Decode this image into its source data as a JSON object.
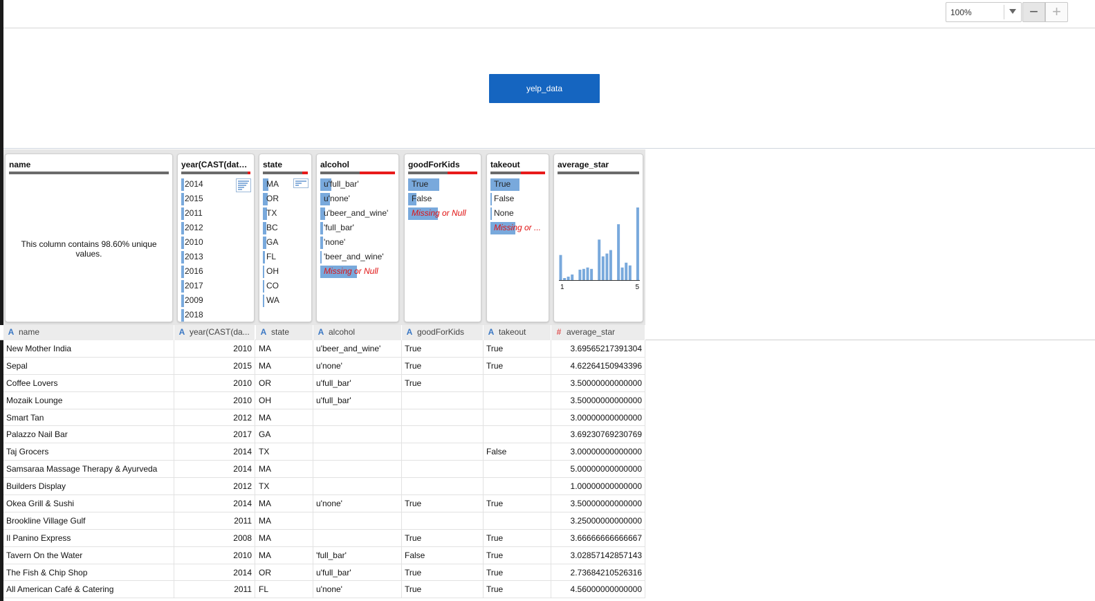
{
  "toolbar": {
    "zoom_value": "100%",
    "zoom_out_symbol": "−",
    "zoom_in_symbol": "+"
  },
  "canvas": {
    "dataset_label": "yelp_data"
  },
  "profile": {
    "name": {
      "title": "name",
      "message": "This column contains 98.60% unique values."
    },
    "year": {
      "title": "year(CAST(date ...",
      "values": [
        {
          "label": "2014",
          "fraction": 0.04
        },
        {
          "label": "2015",
          "fraction": 0.04
        },
        {
          "label": "2011",
          "fraction": 0.04
        },
        {
          "label": "2012",
          "fraction": 0.04
        },
        {
          "label": "2010",
          "fraction": 0.04
        },
        {
          "label": "2013",
          "fraction": 0.04
        },
        {
          "label": "2016",
          "fraction": 0.04
        },
        {
          "label": "2017",
          "fraction": 0.04
        },
        {
          "label": "2009",
          "fraction": 0.04
        },
        {
          "label": "2018",
          "fraction": 0.04
        }
      ],
      "missing_fraction": 0.04
    },
    "state": {
      "title": "state",
      "values": [
        {
          "label": "MA",
          "fraction": 0.12
        },
        {
          "label": "OR",
          "fraction": 0.1
        },
        {
          "label": "TX",
          "fraction": 0.09
        },
        {
          "label": "BC",
          "fraction": 0.08
        },
        {
          "label": "GA",
          "fraction": 0.07
        },
        {
          "label": "FL",
          "fraction": 0.05
        },
        {
          "label": "OH",
          "fraction": 0.03
        },
        {
          "label": "CO",
          "fraction": 0.01
        },
        {
          "label": "WA",
          "fraction": 0.02
        }
      ],
      "missing_fraction": 0.12
    },
    "alcohol": {
      "title": "alcohol",
      "values": [
        {
          "label": "u'full_bar'",
          "fraction": 0.15
        },
        {
          "label": "u'none'",
          "fraction": 0.13
        },
        {
          "label": "u'beer_and_wine'",
          "fraction": 0.06
        },
        {
          "label": "'full_bar'",
          "fraction": 0.04
        },
        {
          "label": "'none'",
          "fraction": 0.04
        },
        {
          "label": "'beer_and_wine'",
          "fraction": 0.02
        },
        {
          "label": "Missing or Null",
          "fraction": 0.49,
          "missing": true
        }
      ],
      "missing_fraction": 0.47
    },
    "goodForKids": {
      "title": "goodForKids",
      "values": [
        {
          "label": "True",
          "fraction": 0.45
        },
        {
          "label": "False",
          "fraction": 0.12
        },
        {
          "label": "Missing or Null",
          "fraction": 0.43,
          "missing": true
        }
      ],
      "missing_fraction": 0.43
    },
    "takeout": {
      "title": "takeout",
      "values": [
        {
          "label": "True",
          "fraction": 0.53
        },
        {
          "label": "False",
          "fraction": 0.03
        },
        {
          "label": "None",
          "fraction": 0.0
        },
        {
          "label": "Missing or ...",
          "fraction": 0.45,
          "missing": true
        }
      ],
      "missing_fraction": 0.44
    },
    "average_star": {
      "title": "average_star",
      "chart_data": {
        "type": "bar",
        "x_range": [
          1,
          5
        ],
        "tick_labels": [
          "1",
          "5"
        ],
        "bins": [
          36,
          3,
          5,
          8,
          0,
          15,
          16,
          18,
          16,
          0,
          58,
          34,
          38,
          43,
          0,
          80,
          18,
          25,
          21,
          0,
          104
        ]
      }
    }
  },
  "columns": [
    {
      "key": "name",
      "label": "name",
      "type": "text"
    },
    {
      "key": "year",
      "label": "year(CAST(da...",
      "type": "text"
    },
    {
      "key": "state",
      "label": "state",
      "type": "text"
    },
    {
      "key": "alcohol",
      "label": "alcohol",
      "type": "text"
    },
    {
      "key": "goodForKids",
      "label": "goodForKids",
      "type": "text"
    },
    {
      "key": "takeout",
      "label": "takeout",
      "type": "text"
    },
    {
      "key": "average_star",
      "label": "average_star",
      "type": "number"
    }
  ],
  "rows": [
    [
      "New Mother India",
      "2010",
      "MA",
      "u'beer_and_wine'",
      "True",
      "True",
      "3.69565217391304"
    ],
    [
      "Sepal",
      "2015",
      "MA",
      "u'none'",
      "True",
      "True",
      "4.62264150943396"
    ],
    [
      "Coffee Lovers",
      "2010",
      "OR",
      "u'full_bar'",
      "True",
      "",
      "3.50000000000000"
    ],
    [
      "Mozaik Lounge",
      "2010",
      "OH",
      "u'full_bar'",
      "",
      "",
      "3.50000000000000"
    ],
    [
      "Smart Tan",
      "2012",
      "MA",
      "",
      "",
      "",
      "3.00000000000000"
    ],
    [
      "Palazzo Nail Bar",
      "2017",
      "GA",
      "",
      "",
      "",
      "3.69230769230769"
    ],
    [
      "Taj Grocers",
      "2014",
      "TX",
      "",
      "",
      "False",
      "3.00000000000000"
    ],
    [
      "Samsaraa Massage Therapy & Ayurveda",
      "2014",
      "MA",
      "",
      "",
      "",
      "5.00000000000000"
    ],
    [
      "Builders Display",
      "2012",
      "TX",
      "",
      "",
      "",
      "1.00000000000000"
    ],
    [
      "Okea Grill & Sushi",
      "2014",
      "MA",
      "u'none'",
      "True",
      "True",
      "3.50000000000000"
    ],
    [
      "Brookline Village Gulf",
      "2011",
      "MA",
      "",
      "",
      "",
      "3.25000000000000"
    ],
    [
      "Il Panino Express",
      "2008",
      "MA",
      "",
      "True",
      "True",
      "3.66666666666667"
    ],
    [
      "Tavern On the Water",
      "2010",
      "MA",
      "'full_bar'",
      "False",
      "True",
      "3.02857142857143"
    ],
    [
      "The Fish & Chip Shop",
      "2014",
      "OR",
      "u'full_bar'",
      "True",
      "True",
      "2.73684210526316"
    ],
    [
      "All American Café & Catering",
      "2011",
      "FL",
      "u'none'",
      "True",
      "True",
      "4.56000000000000"
    ]
  ]
}
